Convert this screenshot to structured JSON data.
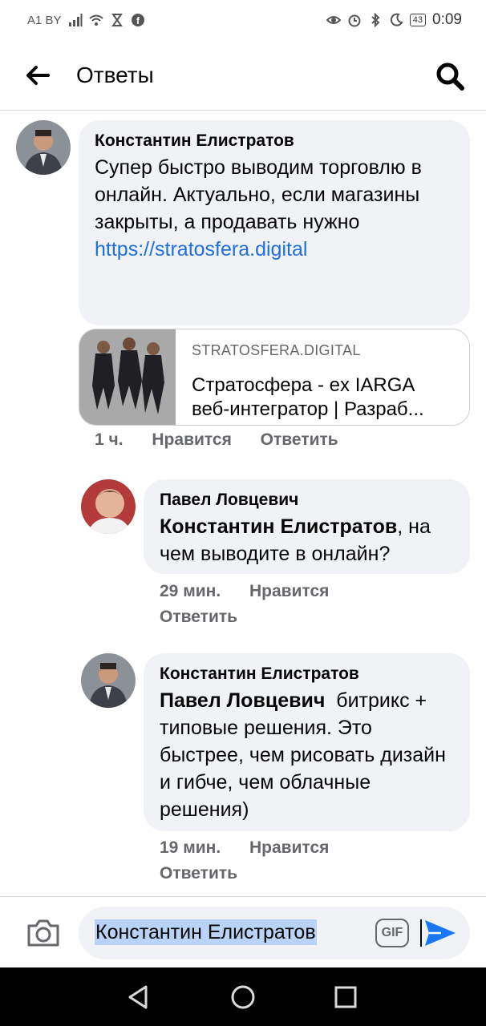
{
  "status_bar": {
    "carrier": "A1 BY",
    "battery": "43",
    "time": "0:09"
  },
  "header": {
    "title": "Ответы"
  },
  "comments": [
    {
      "author": "Константин Елистратов",
      "text": "Супер быстро выводим торговлю в онлайн. Актуально, если магазины закрыты, а продавать нужно",
      "link": "https://stratosfera.digital",
      "time": "1 ч.",
      "like": "Нравится",
      "reply": "Ответить",
      "preview": {
        "domain": "STRATOSFERA.DIGITAL",
        "title_line1": "Стратосфера - ex IARGA",
        "title_line2": "веб-интегратор | Разраб..."
      }
    },
    {
      "author": "Павел Ловцевич",
      "mention": "Константин Елистратов",
      "text": ", на чем выводите в онлайн?",
      "time": "29 мин.",
      "like": "Нравится",
      "reply": "Ответить"
    },
    {
      "author": "Константин Елистратов",
      "mention": "Павел Ловцевич",
      "text": "  битрикс + типовые решения. Это быстрее, чем рисовать дизайн и гибче, чем облачные решения)",
      "time": "19 мин.",
      "like": "Нравится",
      "reply": "Ответить"
    }
  ],
  "composer": {
    "value": "Константин Елистратов",
    "gif_label": "GIF"
  },
  "colors": {
    "bubble": "#f0f2f5",
    "link": "#216fdb",
    "send": "#1877f2",
    "meta": "#65676b"
  }
}
